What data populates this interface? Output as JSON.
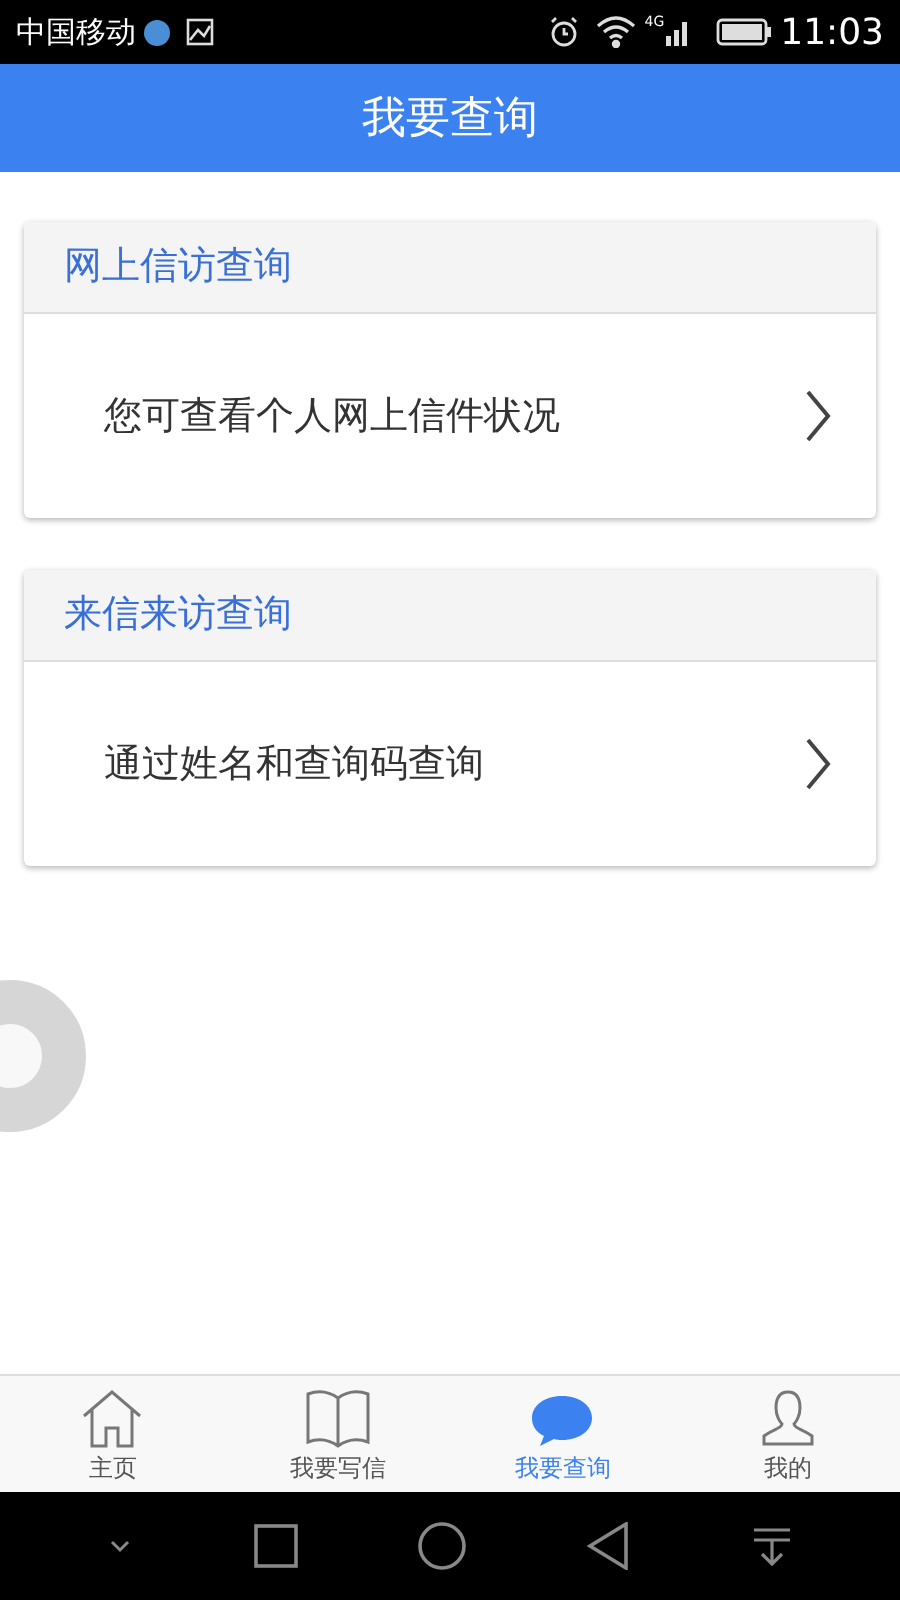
{
  "status_bar": {
    "carrier": "中国移动",
    "signal_label": "4G",
    "time": "11:03"
  },
  "header": {
    "title": "我要查询"
  },
  "cards": [
    {
      "title": "网上信访查询",
      "item": "您可查看个人网上信件状况"
    },
    {
      "title": "来信来访查询",
      "item": "通过姓名和查询码查询"
    }
  ],
  "tabs": [
    {
      "label": "主页",
      "kind": "home",
      "selected": false
    },
    {
      "label": "我要写信",
      "kind": "book",
      "selected": false
    },
    {
      "label": "我要查询",
      "kind": "chat",
      "selected": true
    },
    {
      "label": "我的",
      "kind": "user",
      "selected": false
    }
  ]
}
